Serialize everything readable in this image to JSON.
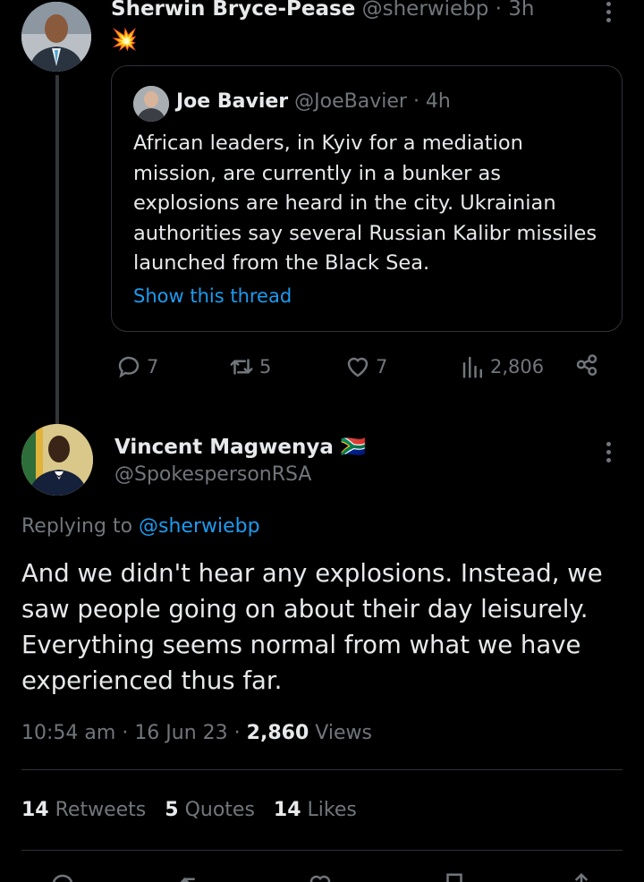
{
  "parent_tweet": {
    "author_name": "Sherwin Bryce-Pease",
    "handle": "@sherwiebp",
    "time": "· 3h",
    "body": "💥",
    "quoted": {
      "author_name": "Joe Bavier",
      "handle": "@JoeBavier",
      "time": "· 4h",
      "text": "African leaders, in Kyiv for a mediation mission, are currently in a bunker as explosions are heard in the city. Ukrainian authorities say several Russian Kalibr missiles launched from the Black Sea.",
      "show_thread": "Show this thread"
    },
    "actions": {
      "replies": "7",
      "retweets": "5",
      "likes": "7",
      "views": "2,806"
    }
  },
  "main_tweet": {
    "author_name": "Vincent Magwenya",
    "flag": "🇿🇦",
    "handle": "@SpokespersonRSA",
    "replying_prefix": "Replying to",
    "replying_handle": "@sherwiebp",
    "text": "And we didn't hear any explosions. Instead, we saw people going on about their day leisurely. Everything seems normal from what we have experienced thus far.",
    "time": "10:54 am",
    "date": "16 Jun 23",
    "views_count": "2,860",
    "views_label": "Views",
    "retweets_count": "14",
    "retweets_label": "Retweets",
    "quotes_count": "5",
    "quotes_label": "Quotes",
    "likes_count": "14",
    "likes_label": "Likes"
  },
  "colors": {
    "background": "#000000",
    "text": "#e7e9ea",
    "secondary": "#71767b",
    "link": "#1d9bf0",
    "divider": "#2f3336"
  }
}
